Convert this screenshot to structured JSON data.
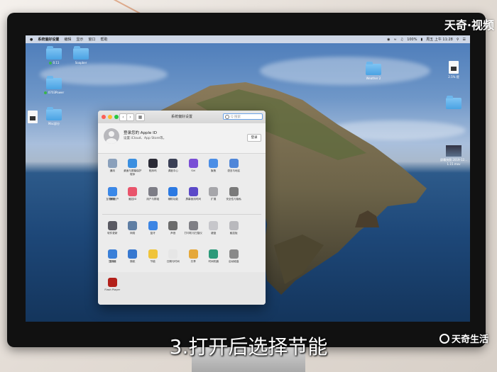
{
  "menubar": {
    "app_name": "系统偏好设置",
    "menus": [
      "编辑",
      "显示",
      "窗口",
      "帮助"
    ],
    "battery": "100%",
    "clock": "周五 上午 11:28"
  },
  "desktop_icons": [
    {
      "label": "0.11"
    },
    {
      "label": "Soapber"
    },
    {
      "label": "0703Power"
    },
    {
      "label": "Mac部分"
    },
    {
      "label": "Weather 2"
    },
    {
      "label": "2.5% 提"
    },
    {
      "label": "屏幕快照 2019-12... 1.15.mov"
    }
  ],
  "window": {
    "title": "系统偏好设置",
    "search_placeholder": "Q 搜索",
    "account_title": "登录您的 Apple ID",
    "account_subtitle": "设置 iCloud、App Store等。",
    "login_button": "登录",
    "row1": [
      {
        "label": "通用",
        "icon": "general-icon",
        "color": "#8aa0bb"
      },
      {
        "label": "桌面与屏幕保护程序",
        "icon": "desktop-icon",
        "color": "#3b8fe0"
      },
      {
        "label": "程序坞",
        "icon": "dock-icon",
        "color": "#2a2a35"
      },
      {
        "label": "调度中心",
        "icon": "mission-control-icon",
        "color": "#3a3f55"
      },
      {
        "label": "Siri",
        "icon": "siri-icon",
        "color": "#7a4fd6"
      },
      {
        "label": "聚焦",
        "icon": "spotlight-icon",
        "color": "#4b8ee6"
      },
      {
        "label": "语言与地区",
        "icon": "language-icon",
        "color": "#4f86d9"
      },
      {
        "label": "通知",
        "icon": "notification-icon",
        "color": "#d8453b"
      }
    ],
    "row2": [
      {
        "label": "互联网帐户",
        "icon": "internet-accounts-icon",
        "color": "#3a88e8"
      },
      {
        "label": "触控ID",
        "icon": "touch-id-icon",
        "color": "#e9546b"
      },
      {
        "label": "用户与群组",
        "icon": "users-icon",
        "color": "#7d7d86"
      },
      {
        "label": "辅助功能",
        "icon": "accessibility-icon",
        "color": "#2b79e2"
      },
      {
        "label": "屏幕使用时间",
        "icon": "screen-time-icon",
        "color": "#5b49c8"
      },
      {
        "label": "扩展",
        "icon": "extensions-icon",
        "color": "#a6a6aa"
      },
      {
        "label": "安全性与隐私",
        "icon": "security-icon",
        "color": "#7a7a7a"
      }
    ],
    "row3": [
      {
        "label": "软件更新",
        "icon": "software-update-icon",
        "color": "#5a5a62"
      },
      {
        "label": "网络",
        "icon": "network-icon",
        "color": "#5f7ea3"
      },
      {
        "label": "蓝牙",
        "icon": "bluetooth-icon",
        "color": "#3c85e4"
      },
      {
        "label": "声音",
        "icon": "sound-icon",
        "color": "#6b6b6b"
      },
      {
        "label": "打印机与扫描仪",
        "icon": "printer-icon",
        "color": "#7f7f85"
      },
      {
        "label": "键盘",
        "icon": "keyboard-icon",
        "color": "#c7c7cb"
      },
      {
        "label": "触控板",
        "icon": "trackpad-icon",
        "color": "#b9b9bd"
      },
      {
        "label": "鼠标",
        "icon": "mouse-icon",
        "color": "#d9d9dc"
      }
    ],
    "row4": [
      {
        "label": "显示器",
        "icon": "displays-icon",
        "color": "#3a7fd8"
      },
      {
        "label": "随航",
        "icon": "sidecar-icon",
        "color": "#3778d0"
      },
      {
        "label": "节能",
        "icon": "energy-saver-icon",
        "color": "#f0c43a"
      },
      {
        "label": "日期与时间",
        "icon": "date-time-icon",
        "color": "#e6e6e6"
      },
      {
        "label": "共享",
        "icon": "sharing-icon",
        "color": "#e5a83a"
      },
      {
        "label": "时间机器",
        "icon": "time-machine-icon",
        "color": "#2c9a7a"
      },
      {
        "label": "启动磁盘",
        "icon": "startup-disk-icon",
        "color": "#8a8a8a"
      }
    ],
    "other": [
      {
        "label": "Flash Player",
        "icon": "flash-player-icon",
        "color": "#b3201a"
      }
    ]
  },
  "caption": "3.打开后选择节能",
  "watermark_top": "天奇·视频",
  "watermark_bottom": "天奇生活"
}
